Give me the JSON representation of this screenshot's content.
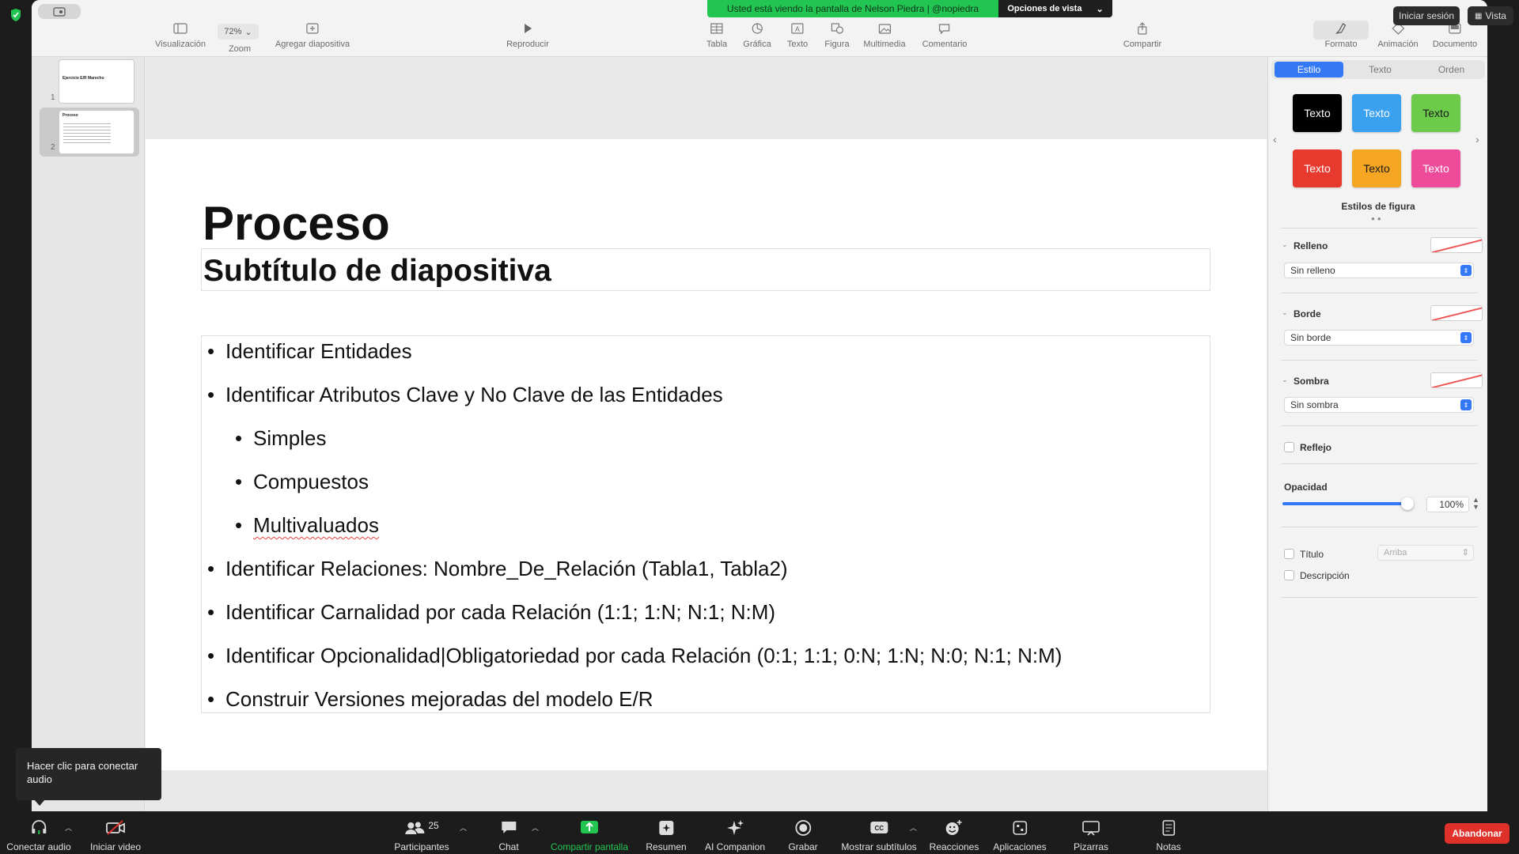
{
  "banner": {
    "text": "Usted está viendo la pantalla de Nelson Piedra | @nopiedra",
    "options_label": "Opciones de vista"
  },
  "top_right": {
    "signin": "Iniciar sesión",
    "view": "Vista"
  },
  "toolbar": {
    "visualizacion": "Visualización",
    "zoom_value": "72%",
    "zoom": "Zoom",
    "agregar": "Agregar diapositiva",
    "reproducir": "Reproducir",
    "tabla": "Tabla",
    "grafica": "Gráfica",
    "texto": "Texto",
    "figura": "Figura",
    "multimedia": "Multimedia",
    "comentario": "Comentario",
    "compartir": "Compartir",
    "formato": "Formato",
    "animacion": "Animación",
    "documento": "Documento"
  },
  "thumbnails": [
    {
      "num": "1",
      "title": "Ejercicio E/R Marecho"
    },
    {
      "num": "2",
      "title": "Proceso"
    }
  ],
  "slide": {
    "title": "Proceso",
    "subtitle": "Subtítulo de diapositiva",
    "bullets": [
      "Identificar Entidades",
      "Identificar Atributos Clave y No Clave de las Entidades",
      "Simples",
      "Compuestos",
      "Multivaluados",
      "Identificar Relaciones: Nombre_De_Relación (Tabla1, Tabla2)",
      "Identificar Carnalidad por cada Relación (1:1; 1:N; N:1; N:M)",
      "Identificar Opcionalidad|Obligatoriedad por cada Relación (0:1; 1:1; 0:N; 1:N; N:0; N:1; N:M)",
      "Construir Versiones mejoradas del modelo E/R"
    ]
  },
  "inspector": {
    "tabs": [
      "Estilo",
      "Texto",
      "Orden"
    ],
    "swatch_label": "Texto",
    "swatch_colors": [
      "#000000",
      "#3aa0f0",
      "#6ccb4a",
      "#e8392f",
      "#f5a623",
      "#ee4b9a"
    ],
    "styles_caption": "Estilos de figura",
    "relleno": "Relleno",
    "relleno_value": "Sin relleno",
    "borde": "Borde",
    "borde_value": "Sin borde",
    "sombra": "Sombra",
    "sombra_value": "Sin sombra",
    "reflejo": "Reflejo",
    "opacidad": "Opacidad",
    "opacidad_value": "100%",
    "opacity_level": 1.0,
    "titulo": "Título",
    "titulo_pos": "Arriba",
    "descripcion": "Descripción"
  },
  "tooltip": "Hacer clic para conectar audio",
  "bottom": {
    "conectar_audio": "Conectar audio",
    "iniciar_video": "Iniciar video",
    "participantes": "Participantes",
    "participants_count": "25",
    "chat": "Chat",
    "compartir_pantalla": "Compartir pantalla",
    "resumen": "Resumen",
    "ai_companion": "AI Companion",
    "grabar": "Grabar",
    "subtitulos": "Mostrar subtítulos",
    "reacciones": "Reacciones",
    "aplicaciones": "Aplicaciones",
    "pizarras": "Pizarras",
    "notas": "Notas",
    "abandonar": "Abandonar"
  },
  "colors": {
    "share_green": "#23c552",
    "leave_red": "#e0302a",
    "accent_blue": "#3478f6"
  }
}
